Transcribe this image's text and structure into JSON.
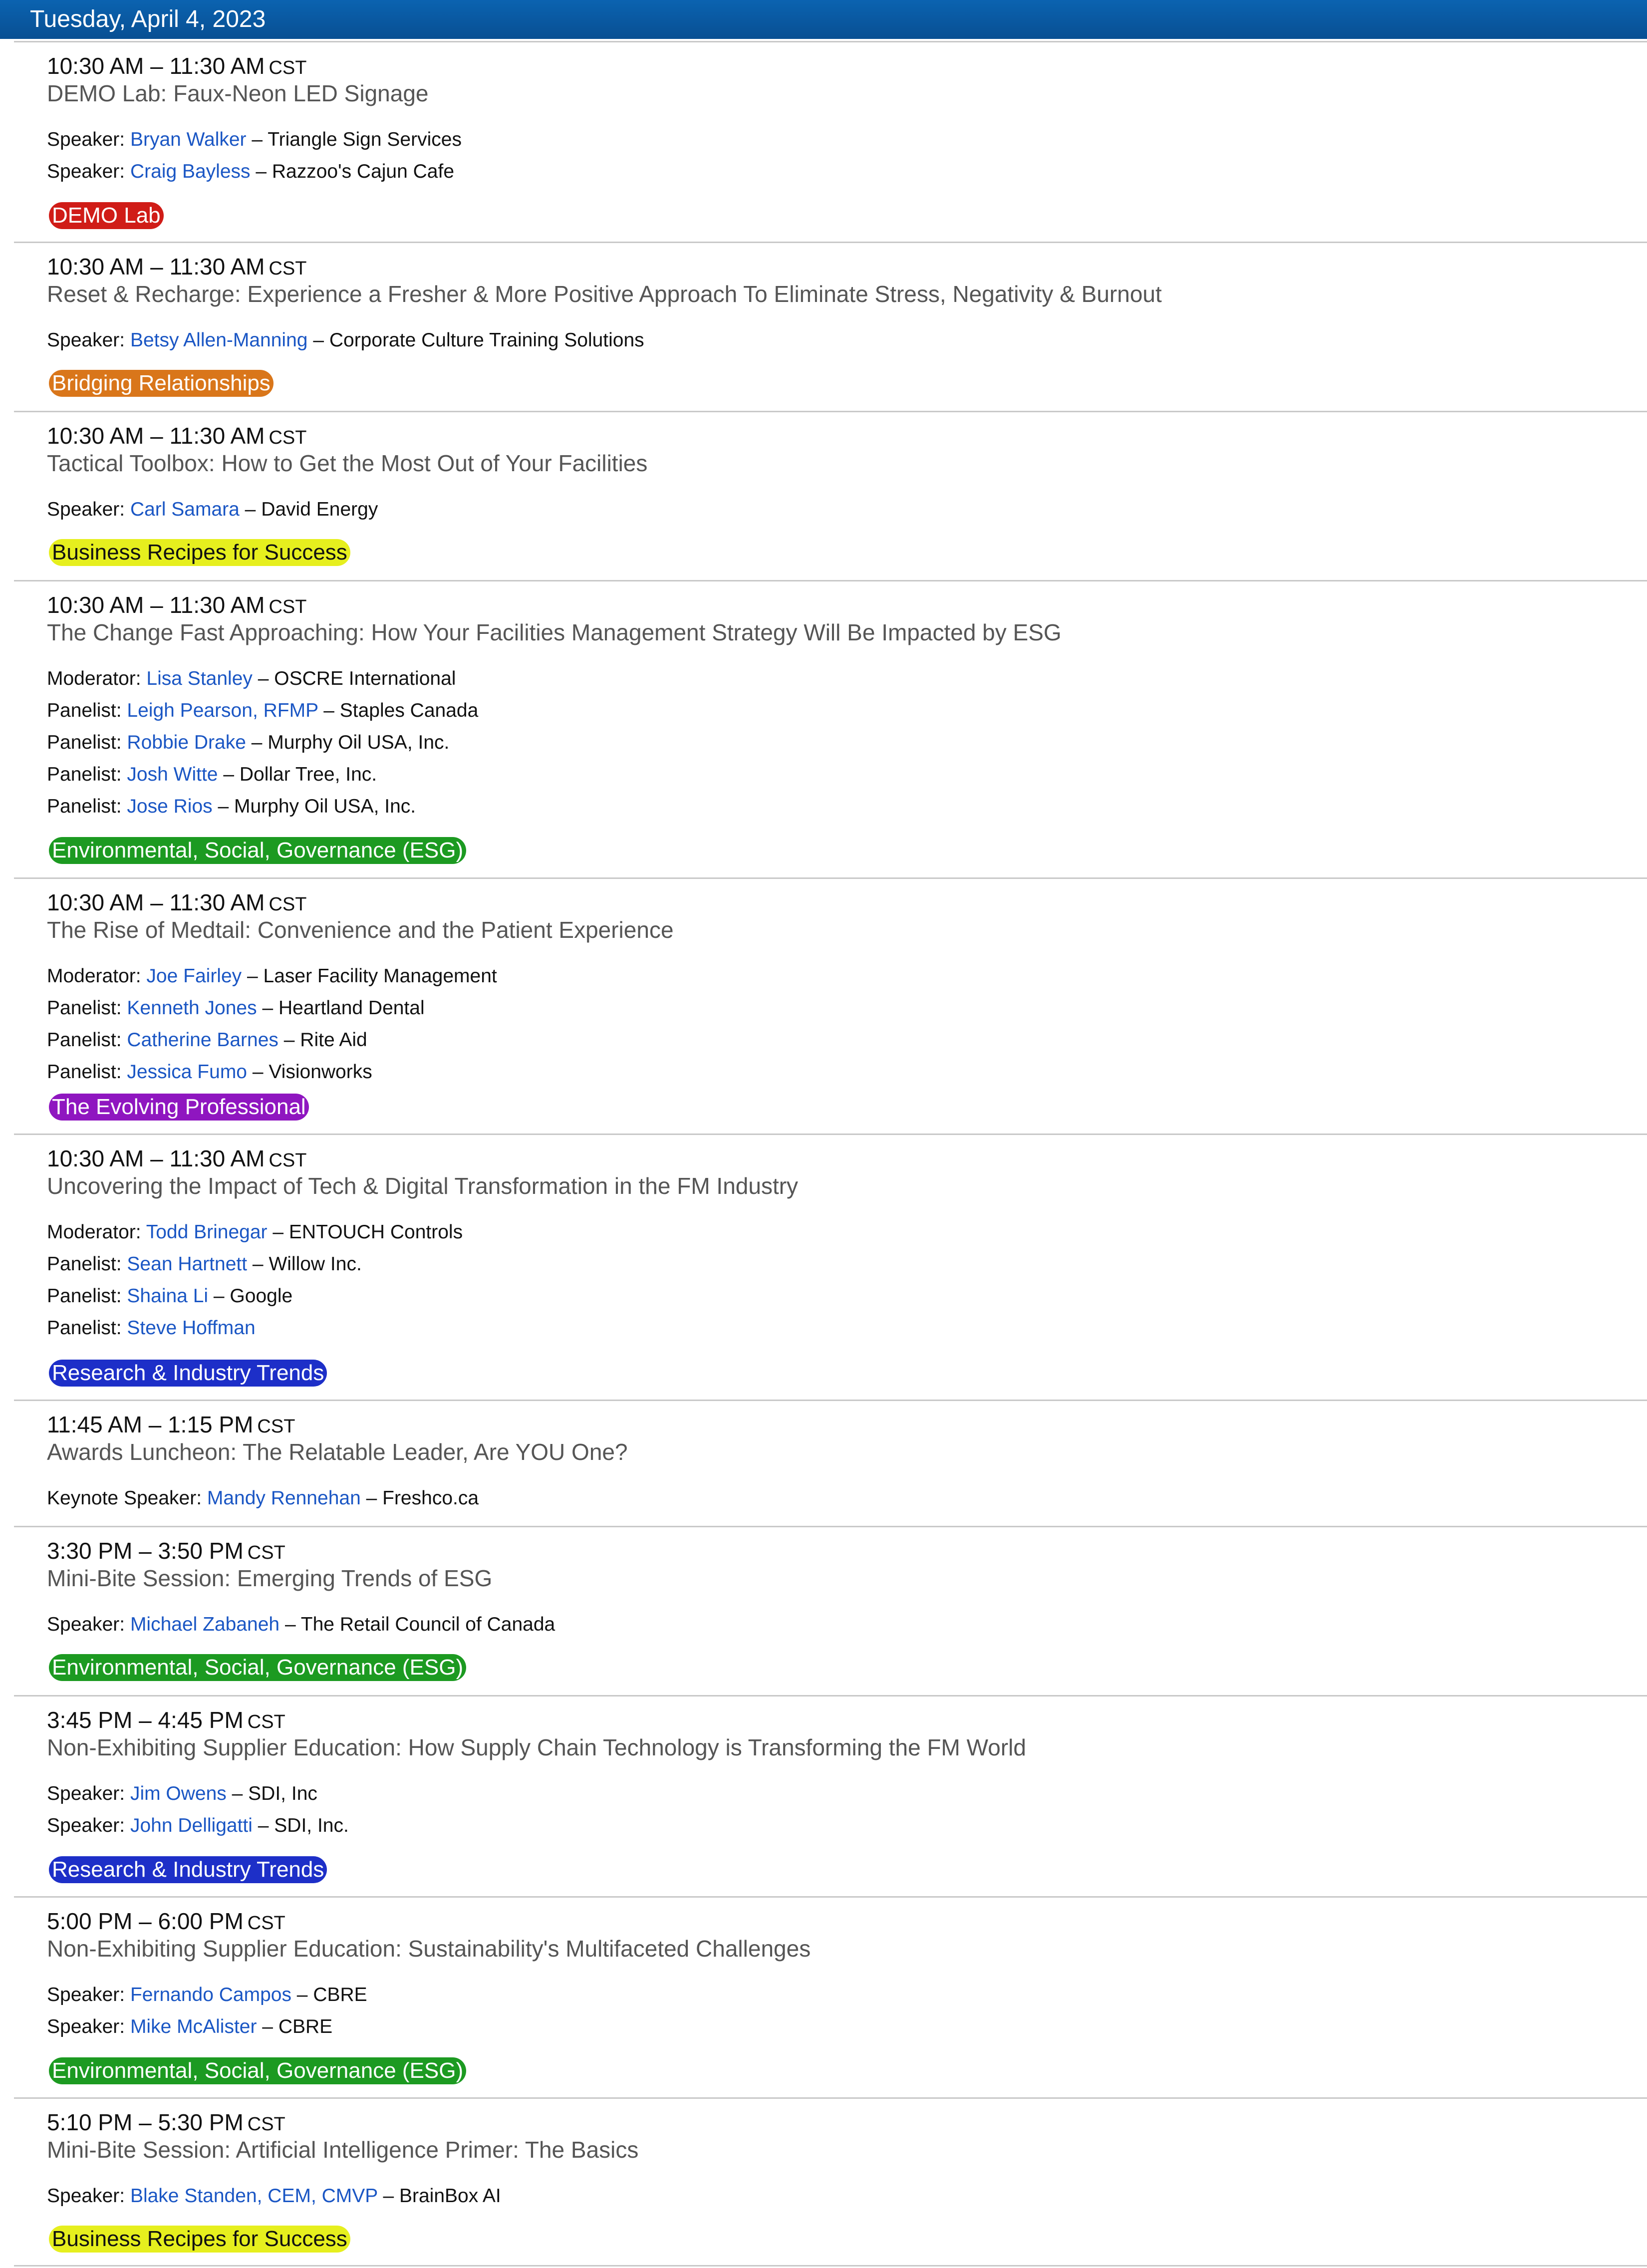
{
  "day_header": "Tuesday, April 4, 2023",
  "colors": {
    "header": "#0b63b0",
    "link": "#1a56c4",
    "tag_red": "#d01c17",
    "tag_orange": "#d9761a",
    "tag_yellow": "#e6ef1e",
    "tag_green": "#1c9a21",
    "tag_purple": "#8f16c0",
    "tag_blue": "#1d2fc8"
  },
  "sessions": [
    {
      "time": "10:30 AM – 11:30 AM",
      "tz": "CST",
      "title": "DEMO Lab: Faux-Neon LED Signage",
      "people": [
        {
          "role": "Speaker: ",
          "name": "Bryan Walker",
          "org": " – Triangle Sign Services"
        },
        {
          "role": "Speaker: ",
          "name": "Craig Bayless",
          "org": " – Razzoo's Cajun Cafe"
        }
      ],
      "tag": "DEMO Lab"
    },
    {
      "time": "10:30 AM – 11:30 AM",
      "tz": "CST",
      "title": "Reset & Recharge: Experience a Fresher & More Positive Approach To Eliminate Stress, Negativity & Burnout",
      "people": [
        {
          "role": "Speaker: ",
          "name": "Betsy Allen-Manning",
          "org": " – Corporate Culture Training Solutions"
        }
      ],
      "tag": "Bridging Relationships"
    },
    {
      "time": "10:30 AM – 11:30 AM",
      "tz": "CST",
      "title": "Tactical Toolbox: How to Get the Most Out of Your Facilities",
      "people": [
        {
          "role": "Speaker: ",
          "name": "Carl Samara",
          "org": " – David Energy"
        }
      ],
      "tag": "Business Recipes for Success"
    },
    {
      "time": "10:30 AM – 11:30 AM",
      "tz": "CST",
      "title": "The Change Fast Approaching: How Your Facilities Management Strategy Will Be Impacted by ESG",
      "people": [
        {
          "role": "Moderator: ",
          "name": "Lisa Stanley",
          "org": " – OSCRE International"
        },
        {
          "role": "Panelist: ",
          "name": "Leigh Pearson, RFMP",
          "org": " – Staples Canada"
        },
        {
          "role": "Panelist: ",
          "name": "Robbie Drake",
          "org": " – Murphy Oil USA, Inc."
        },
        {
          "role": "Panelist: ",
          "name": "Josh Witte",
          "org": " – Dollar Tree, Inc."
        },
        {
          "role": "Panelist: ",
          "name": "Jose Rios",
          "org": " – Murphy Oil USA, Inc."
        }
      ],
      "tag": "Environmental, Social, Governance (ESG)"
    },
    {
      "time": "10:30 AM – 11:30 AM",
      "tz": "CST",
      "title": "The Rise of Medtail: Convenience and the Patient Experience",
      "people": [
        {
          "role": "Moderator: ",
          "name": "Joe Fairley",
          "org": " – Laser Facility Management"
        },
        {
          "role": "Panelist: ",
          "name": "Kenneth Jones",
          "org": " – Heartland Dental"
        },
        {
          "role": "Panelist: ",
          "name": "Catherine Barnes",
          "org": " – Rite Aid"
        },
        {
          "role": "Panelist: ",
          "name": "Jessica Fumo",
          "org": " – Visionworks"
        }
      ],
      "tag": "The Evolving Professional"
    },
    {
      "time": "10:30 AM – 11:30 AM",
      "tz": "CST",
      "title": "Uncovering the Impact of Tech & Digital Transformation in the FM Industry",
      "people": [
        {
          "role": "Moderator: ",
          "name": "Todd Brinegar",
          "org": " – ENTOUCH Controls"
        },
        {
          "role": "Panelist: ",
          "name": "Sean Hartnett",
          "org": " – Willow Inc."
        },
        {
          "role": "Panelist: ",
          "name": "Shaina Li",
          "org": " – Google"
        },
        {
          "role": "Panelist: ",
          "name": "Steve Hoffman",
          "org": ""
        }
      ],
      "tag": "Research & Industry Trends"
    },
    {
      "time": "11:45 AM – 1:15 PM",
      "tz": "CST",
      "title": "Awards Luncheon: The Relatable Leader, Are YOU One?",
      "people": [
        {
          "role": "Keynote Speaker: ",
          "name": "Mandy Rennehan",
          "org": " – Freshco.ca"
        }
      ],
      "tag": ""
    },
    {
      "time": "3:30 PM – 3:50 PM",
      "tz": "CST",
      "title": "Mini-Bite Session: Emerging Trends of ESG",
      "people": [
        {
          "role": "Speaker: ",
          "name": "Michael Zabaneh",
          "org": " – The Retail Council of Canada"
        }
      ],
      "tag": "Environmental, Social, Governance (ESG)"
    },
    {
      "time": "3:45 PM – 4:45 PM",
      "tz": "CST",
      "title": "Non-Exhibiting Supplier Education: How Supply Chain Technology is Transforming the FM World",
      "people": [
        {
          "role": "Speaker: ",
          "name": "Jim Owens",
          "org": " – SDI, Inc"
        },
        {
          "role": "Speaker: ",
          "name": "John Delligatti",
          "org": " – SDI, Inc."
        }
      ],
      "tag": "Research & Industry Trends"
    },
    {
      "time": "5:00 PM – 6:00 PM",
      "tz": "CST",
      "title": "Non-Exhibiting Supplier Education: Sustainability's Multifaceted Challenges",
      "people": [
        {
          "role": "Speaker: ",
          "name": "Fernando Campos",
          "org": " – CBRE"
        },
        {
          "role": "Speaker: ",
          "name": "Mike McAlister",
          "org": " – CBRE"
        }
      ],
      "tag": "Environmental, Social, Governance (ESG)"
    },
    {
      "time": "5:10 PM – 5:30 PM",
      "tz": "CST",
      "title": "Mini-Bite Session: Artificial Intelligence Primer: The Basics",
      "people": [
        {
          "role": "Speaker: ",
          "name": "Blake Standen, CEM, CMVP",
          "org": " – BrainBox AI"
        }
      ],
      "tag": "Business Recipes for Success"
    }
  ]
}
